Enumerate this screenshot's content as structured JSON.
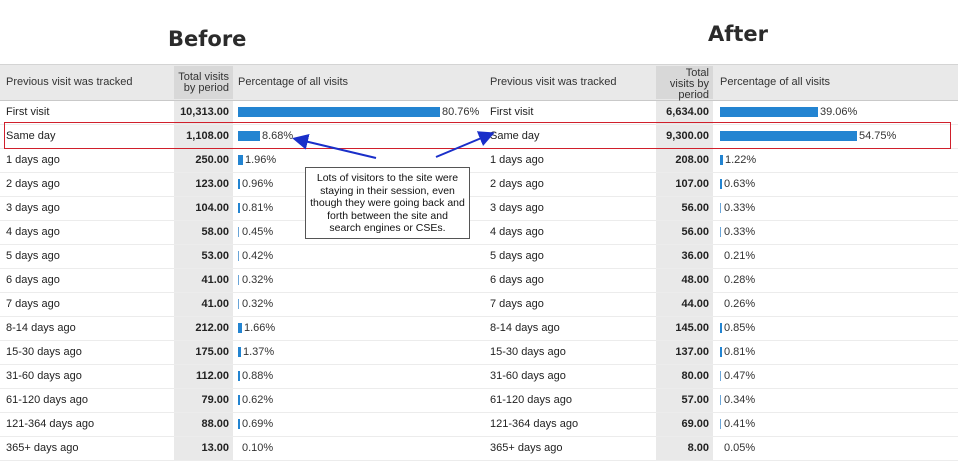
{
  "colors": {
    "bar": "#2384d1",
    "highlight": "#d01f2b"
  },
  "chart_data": [
    {
      "type": "bar",
      "title": "Before",
      "columns": [
        "Previous visit was tracked",
        "Total visits by period",
        "Percentage of all visits"
      ],
      "header": {
        "c1": "Previous visit was tracked",
        "c2a": "Total visits",
        "c2b": "by period",
        "c2c": "",
        "c3": "Percentage of all visits"
      },
      "rows": [
        {
          "label": "First visit",
          "total": "10,313.00",
          "pct": 80.76,
          "pct_text": "80.76%"
        },
        {
          "label": "Same day",
          "total": "1,108.00",
          "pct": 8.68,
          "pct_text": "8.68%"
        },
        {
          "label": "1 days ago",
          "total": "250.00",
          "pct": 1.96,
          "pct_text": "1.96%"
        },
        {
          "label": "2 days ago",
          "total": "123.00",
          "pct": 0.96,
          "pct_text": "0.96%"
        },
        {
          "label": "3 days ago",
          "total": "104.00",
          "pct": 0.81,
          "pct_text": "0.81%"
        },
        {
          "label": "4 days ago",
          "total": "58.00",
          "pct": 0.45,
          "pct_text": "0.45%"
        },
        {
          "label": "5 days ago",
          "total": "53.00",
          "pct": 0.42,
          "pct_text": "0.42%"
        },
        {
          "label": "6 days ago",
          "total": "41.00",
          "pct": 0.32,
          "pct_text": "0.32%"
        },
        {
          "label": "7 days ago",
          "total": "41.00",
          "pct": 0.32,
          "pct_text": "0.32%"
        },
        {
          "label": "8-14 days ago",
          "total": "212.00",
          "pct": 1.66,
          "pct_text": "1.66%"
        },
        {
          "label": "15-30 days ago",
          "total": "175.00",
          "pct": 1.37,
          "pct_text": "1.37%"
        },
        {
          "label": "31-60 days ago",
          "total": "112.00",
          "pct": 0.88,
          "pct_text": "0.88%"
        },
        {
          "label": "61-120 days ago",
          "total": "79.00",
          "pct": 0.62,
          "pct_text": "0.62%"
        },
        {
          "label": "121-364 days ago",
          "total": "88.00",
          "pct": 0.69,
          "pct_text": "0.69%"
        },
        {
          "label": "365+ days ago",
          "total": "13.00",
          "pct": 0.1,
          "pct_text": "0.10%"
        }
      ]
    },
    {
      "type": "bar",
      "title": "After",
      "columns": [
        "Previous visit was tracked",
        "Total visits by period",
        "Percentage of all visits"
      ],
      "header": {
        "c1": "Previous visit was tracked",
        "c2a": "Total",
        "c2b": "visits by",
        "c2c": "period",
        "c3": "Percentage of all visits"
      },
      "rows": [
        {
          "label": "First visit",
          "total": "6,634.00",
          "pct": 39.06,
          "pct_text": "39.06%"
        },
        {
          "label": "Same day",
          "total": "9,300.00",
          "pct": 54.75,
          "pct_text": "54.75%"
        },
        {
          "label": "1 days ago",
          "total": "208.00",
          "pct": 1.22,
          "pct_text": "1.22%"
        },
        {
          "label": "2 days ago",
          "total": "107.00",
          "pct": 0.63,
          "pct_text": "0.63%"
        },
        {
          "label": "3 days ago",
          "total": "56.00",
          "pct": 0.33,
          "pct_text": "0.33%"
        },
        {
          "label": "4 days ago",
          "total": "56.00",
          "pct": 0.33,
          "pct_text": "0.33%"
        },
        {
          "label": "5 days ago",
          "total": "36.00",
          "pct": 0.21,
          "pct_text": "0.21%"
        },
        {
          "label": "6 days ago",
          "total": "48.00",
          "pct": 0.28,
          "pct_text": "0.28%"
        },
        {
          "label": "7 days ago",
          "total": "44.00",
          "pct": 0.26,
          "pct_text": "0.26%"
        },
        {
          "label": "8-14 days ago",
          "total": "145.00",
          "pct": 0.85,
          "pct_text": "0.85%"
        },
        {
          "label": "15-30 days ago",
          "total": "137.00",
          "pct": 0.81,
          "pct_text": "0.81%"
        },
        {
          "label": "31-60 days ago",
          "total": "80.00",
          "pct": 0.47,
          "pct_text": "0.47%"
        },
        {
          "label": "61-120 days ago",
          "total": "57.00",
          "pct": 0.34,
          "pct_text": "0.34%"
        },
        {
          "label": "121-364 days ago",
          "total": "69.00",
          "pct": 0.41,
          "pct_text": "0.41%"
        },
        {
          "label": "365+ days ago",
          "total": "8.00",
          "pct": 0.05,
          "pct_text": "0.05%"
        }
      ]
    }
  ],
  "callout": {
    "text": "Lots of visitors to the site were staying in their session, even though they were going back and forth between the site and search engines or CSEs."
  }
}
